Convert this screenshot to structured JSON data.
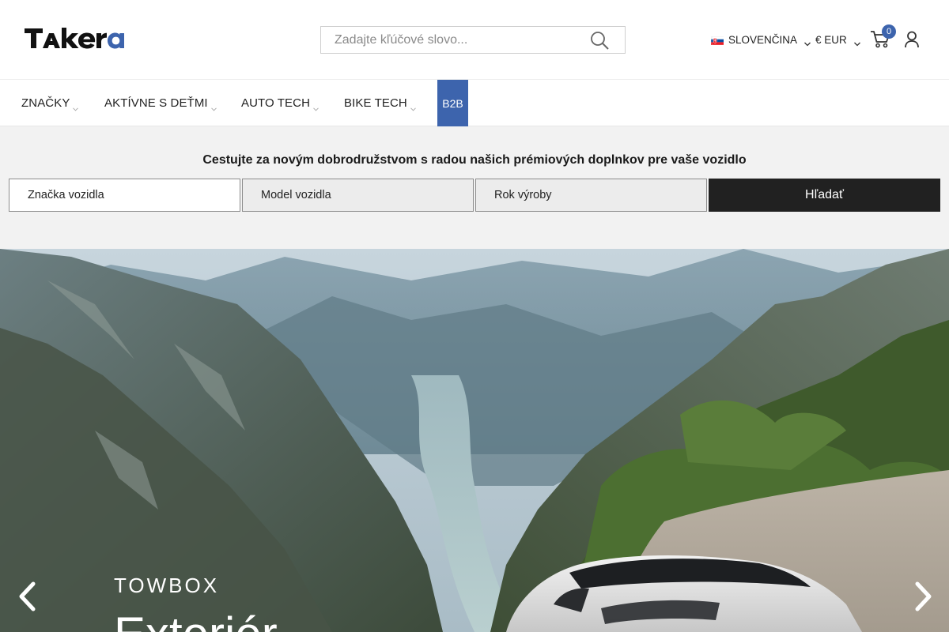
{
  "header": {
    "logo_text": "Takera",
    "search": {
      "placeholder": "Zadajte kľúčové slovo...",
      "value": ""
    },
    "language": {
      "label": "SLOVENČINA",
      "flag": "sk-flag-icon"
    },
    "currency": {
      "label": "€ EUR"
    },
    "cart": {
      "count": "0"
    }
  },
  "nav": {
    "items": [
      {
        "label": "ZNAČKY"
      },
      {
        "label": "AKTÍVNE S DEŤMI"
      },
      {
        "label": "AUTO TECH"
      },
      {
        "label": "BIKE TECH"
      }
    ],
    "b2b_label": "B2B"
  },
  "finder": {
    "title": "Cestujte za novým dobrodružstvom s radou našich prémiových doplnkov pre vaše vozidlo",
    "make_label": "Značka vozidla",
    "model_label": "Model vozidla",
    "year_label": "Rok výroby",
    "search_label": "Hľadať"
  },
  "hero": {
    "eyebrow": "TOWBOX",
    "title": "Exteriér"
  },
  "colors": {
    "accent": "#3d64ad",
    "button_dark": "#212121",
    "finder_bg": "#f2f2f2"
  }
}
